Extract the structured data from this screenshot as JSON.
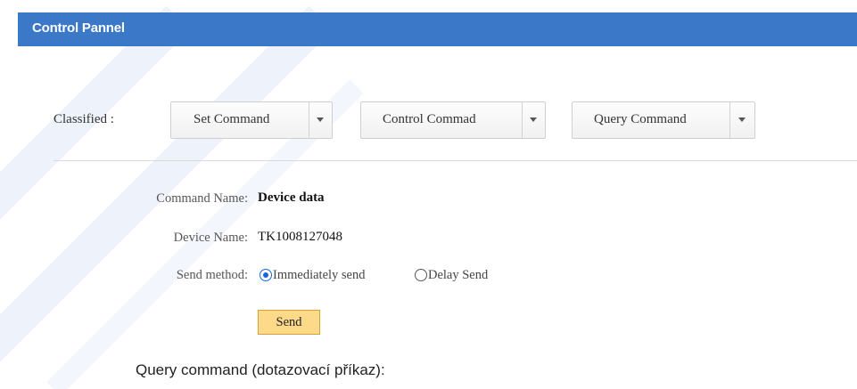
{
  "panel": {
    "title": "Control Pannel"
  },
  "classified": {
    "label": "Classified :",
    "dropdowns": [
      {
        "label": "Set Command"
      },
      {
        "label": "Control Commad"
      },
      {
        "label": "Query Command"
      }
    ]
  },
  "form": {
    "command_name_label": "Command Name:",
    "command_name_value": "Device data",
    "device_name_label": "Device Name:",
    "device_name_value": "TK1008127048",
    "send_method_label": "Send method:",
    "send_methods": [
      {
        "label": "Immediately send",
        "checked": true
      },
      {
        "label": "Delay Send",
        "checked": false
      }
    ],
    "send_button": "Send"
  },
  "caption": "Query command (dotazovací příkaz):",
  "colors": {
    "header": "#3b78c8",
    "send_button": "#fdd98a",
    "radio_active": "#1a66d6"
  }
}
